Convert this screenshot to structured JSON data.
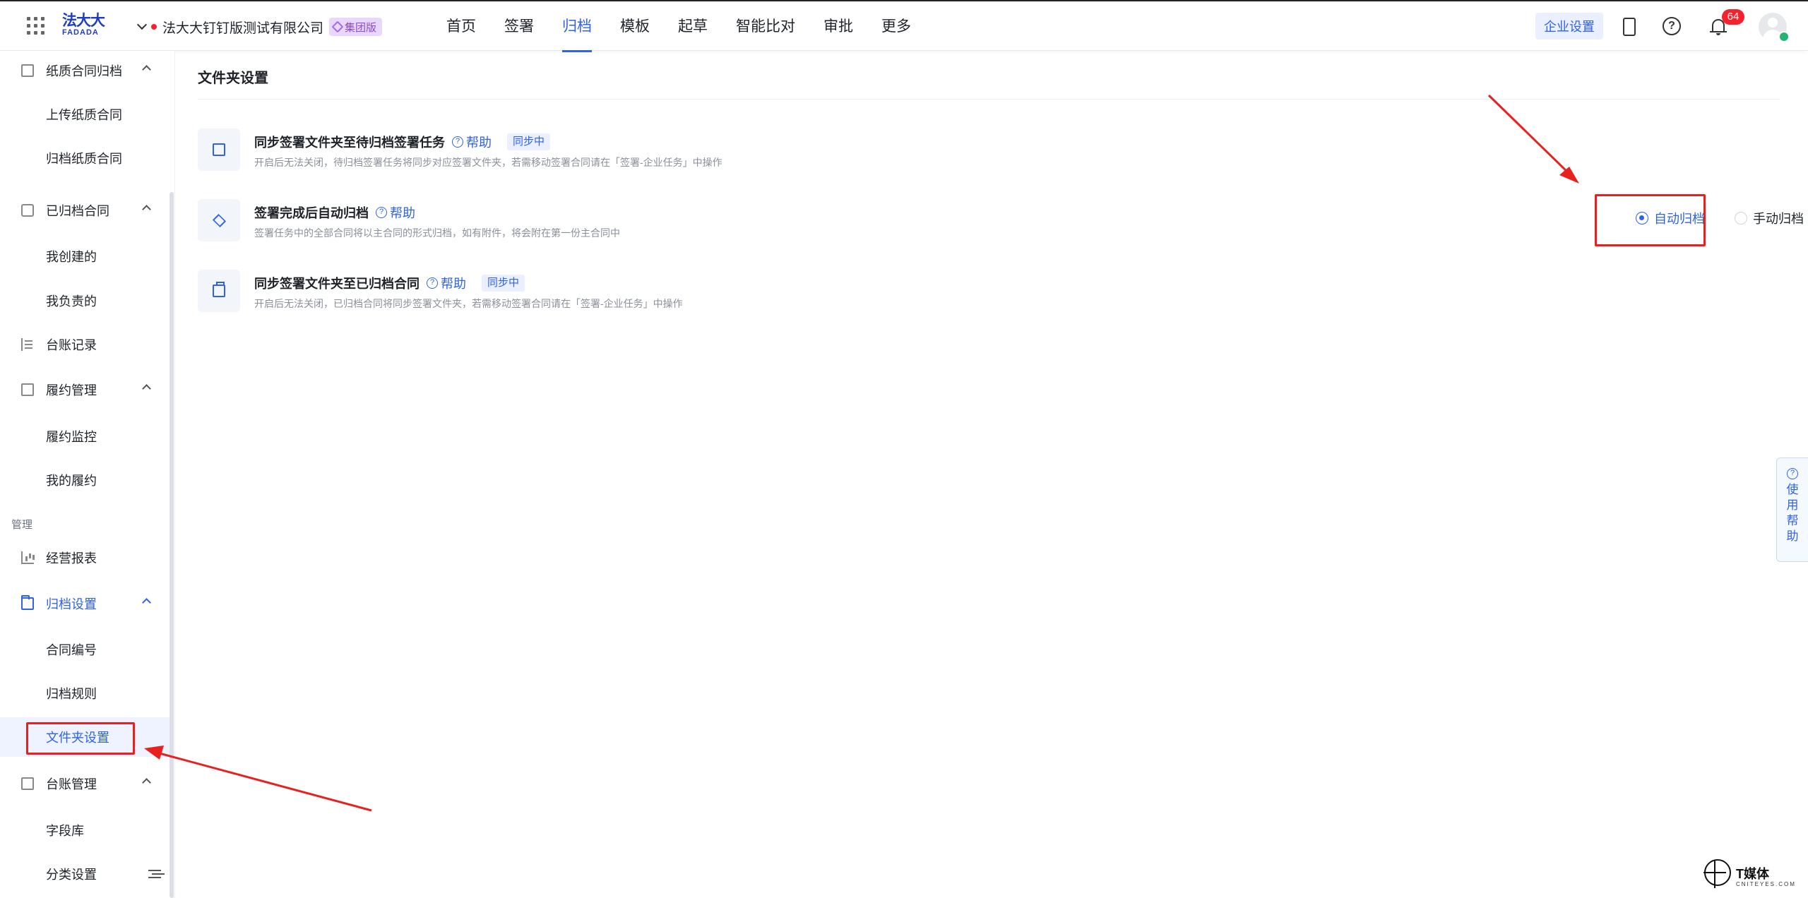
{
  "header": {
    "logo_cn": "法大大",
    "logo_en": "FADADA",
    "company_name": "法大大钉钉版测试有限公司",
    "edition_badge": "集团版",
    "nav": [
      {
        "label": "首页"
      },
      {
        "label": "签署"
      },
      {
        "label": "归档",
        "active": true
      },
      {
        "label": "模板"
      },
      {
        "label": "起草"
      },
      {
        "label": "智能比对"
      },
      {
        "label": "审批"
      },
      {
        "label": "更多"
      }
    ],
    "enterprise_settings": "企业设置",
    "notification_count": "64"
  },
  "sidebar": {
    "paper_archive": {
      "label": "纸质合同归档",
      "children": [
        "上传纸质合同",
        "归档纸质合同"
      ]
    },
    "archived_contracts": {
      "label": "已归档合同",
      "children": [
        "我创建的",
        "我负责的"
      ]
    },
    "ledger_records": {
      "label": "台账记录"
    },
    "performance_mgmt": {
      "label": "履约管理",
      "children": [
        "履约监控",
        "我的履约"
      ]
    },
    "section_manage": "管理",
    "business_report": {
      "label": "经营报表"
    },
    "archive_settings": {
      "label": "归档设置",
      "children": [
        "合同编号",
        "归档规则",
        "文件夹设置"
      ]
    },
    "ledger_mgmt": {
      "label": "台账管理",
      "children": [
        "字段库",
        "分类设置"
      ]
    }
  },
  "main": {
    "page_title": "文件夹设置",
    "settings": [
      {
        "title": "同步签署文件夹至待归档签署任务",
        "help": "帮助",
        "badge": "同步中",
        "desc": "开启后无法关闭，待归档签署任务将同步对应签署文件夹，若需移动签署合同请在「签署-企业任务」中操作"
      },
      {
        "title": "签署完成后自动归档",
        "help": "帮助",
        "desc": "签署任务中的全部合同将以主合同的形式归档，如有附件，将会附在第一份主合同中",
        "options": [
          "自动归档",
          "手动归档"
        ],
        "selected": "自动归档"
      },
      {
        "title": "同步签署文件夹至已归档合同",
        "help": "帮助",
        "badge": "同步中",
        "desc": "开启后无法关闭，已归档合同将同步签署文件夹，若需移动签署合同请在「签署-企业任务」中操作"
      }
    ]
  },
  "float_help": "使用帮助",
  "watermark": {
    "cn": "T媒体",
    "en": "CNITEYES.COM"
  },
  "colors": {
    "primary": "#2f62e8",
    "annotation": "#e8211f",
    "badge_red": "#f5222d"
  }
}
